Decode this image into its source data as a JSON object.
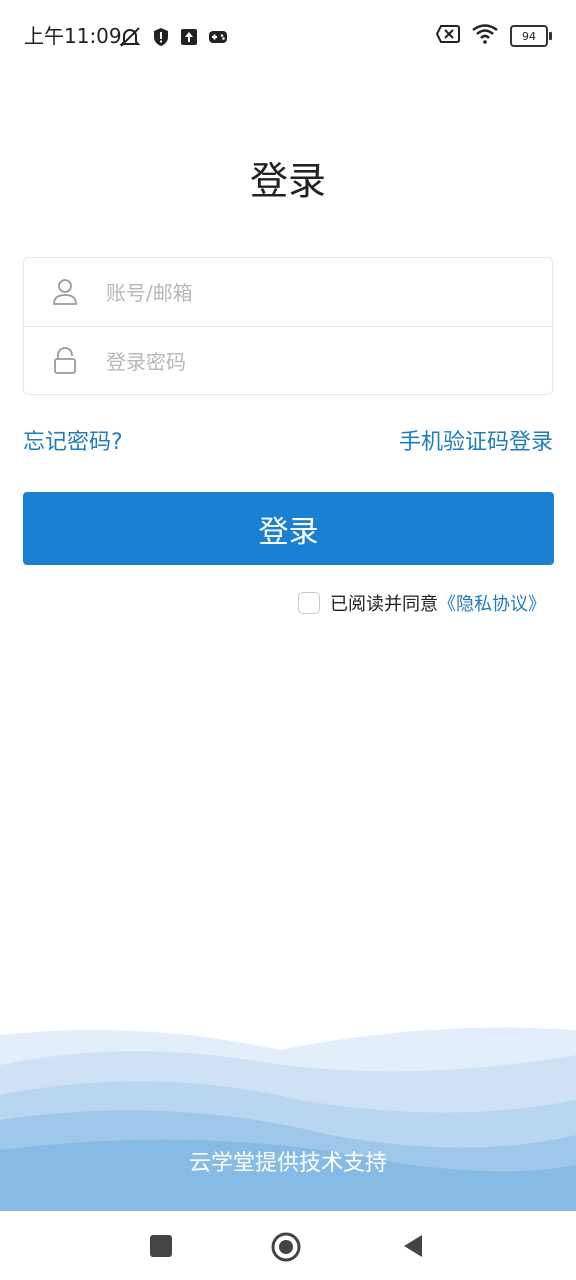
{
  "status_bar": {
    "time": "上午11:09",
    "battery": "94",
    "left_icons": [
      "bell-off-icon",
      "shield-icon",
      "upload-icon",
      "gamepad-icon"
    ],
    "right_icons": [
      "sim-off-icon",
      "wifi-icon",
      "battery-icon"
    ]
  },
  "page": {
    "title": "登录"
  },
  "form": {
    "account_placeholder": "账号/邮箱",
    "password_placeholder": "登录密码",
    "account_icon": "user-icon",
    "password_icon": "lock-icon"
  },
  "links": {
    "forgot_password": "忘记密码?",
    "sms_login": "手机验证码登录"
  },
  "login_button": {
    "label": "登录"
  },
  "agreement": {
    "text": "已阅读并同意",
    "privacy_link": "《隐私协议》",
    "checked": false
  },
  "footer": {
    "text": "云学堂提供技术支持"
  },
  "nav_bar": {
    "items": [
      "recents-square-icon",
      "home-circle-icon",
      "back-triangle-icon"
    ]
  },
  "colors": {
    "accent": "#1a80d2",
    "link": "#1f7dbf",
    "wave_light": "#e3eefb",
    "wave_mid": "#b9d6f0",
    "wave_dark": "#86bbe6"
  }
}
